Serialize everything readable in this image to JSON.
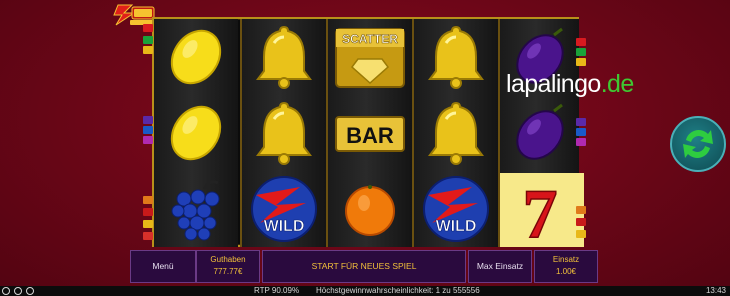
{
  "brand": {
    "name": "lapalingo",
    "tld": ".de"
  },
  "controls": {
    "menu_label": "Menü",
    "balance_label": "Guthaben",
    "balance_value": "777.77€",
    "start_label": "START FÜR NEUES SPIEL",
    "max_bet_label": "Max Einsatz",
    "bet_label": "Einsatz",
    "bet_value": "1.00€"
  },
  "status": {
    "rtp": "RTP 90.09%",
    "win_probability": "Höchstgewinnwahrscheinlichkeit: 1 zu 555556",
    "time": "13:43"
  },
  "reels": [
    [
      "lemon-icon",
      "lemon-icon",
      "grapes-icon"
    ],
    [
      "bell-icon",
      "bell-icon",
      "wild-icon"
    ],
    [
      "scatter-icon",
      "bar-icon",
      "orange-icon"
    ],
    [
      "bell-icon",
      "bell-icon",
      "wild-icon"
    ],
    [
      "plum-icon",
      "plum-icon",
      "seven-icon"
    ]
  ],
  "symbols": {
    "scatter_text": "SCATTER",
    "bar_text": "BAR",
    "wild_text": "WILD",
    "seven_text": "7"
  },
  "colors": {
    "accent_gold": "#f2c13a",
    "panel": "#2a0a3e",
    "background": "#6a0617",
    "brand_tld": "#3fc832"
  }
}
